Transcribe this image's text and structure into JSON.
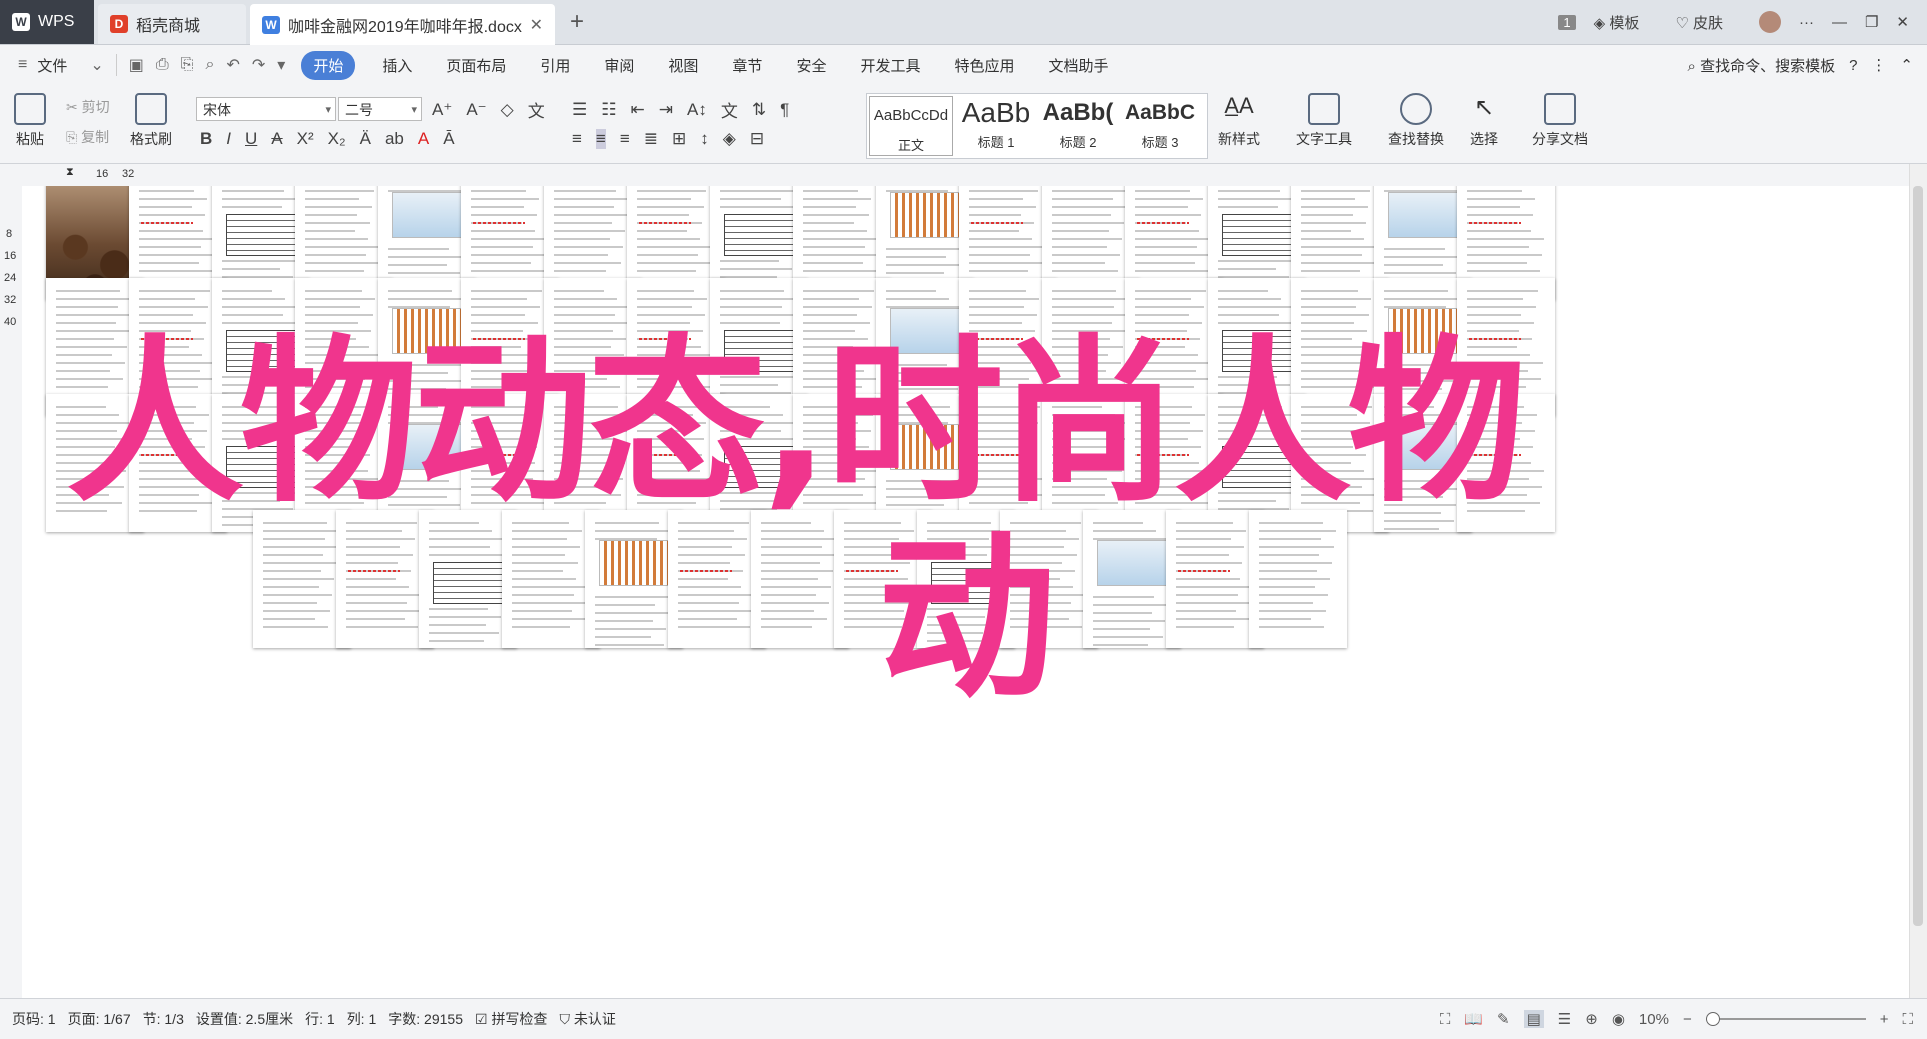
{
  "tabs": {
    "wps": "WPS",
    "shop": "稻壳商城",
    "doc": "咖啡金融网2019年咖啡年报.docx",
    "titlebar_right": {
      "page_badge": "1",
      "template": "模板",
      "skin": "皮肤"
    }
  },
  "menu": {
    "file": "文件",
    "items": [
      "开始",
      "插入",
      "页面布局",
      "引用",
      "审阅",
      "视图",
      "章节",
      "安全",
      "开发工具",
      "特色应用",
      "文档助手"
    ],
    "active": "开始",
    "search": "查找命令、搜索模板"
  },
  "ribbon": {
    "paste": "粘贴",
    "cut": "剪切",
    "copy": "复制",
    "format_painter": "格式刷",
    "font_name": "宋体",
    "font_size": "二号",
    "styles": [
      {
        "sample": "AaBbCcDd",
        "label": "正文"
      },
      {
        "sample": "AaBb",
        "label": "标题 1"
      },
      {
        "sample": "AaBb(",
        "label": "标题 2"
      },
      {
        "sample": "AaBbC",
        "label": "标题 3"
      }
    ],
    "new_style": "新样式",
    "text_tools": "文字工具",
    "find_replace": "查找替换",
    "select": "选择",
    "share": "分享文档"
  },
  "ruler": {
    "h_marks": [
      "16",
      "32"
    ],
    "v_marks": [
      "8",
      "16",
      "24",
      "32",
      "40"
    ]
  },
  "overlay": {
    "line1": "人物动态,时尚人物",
    "line2": "动"
  },
  "status": {
    "page": "页码: 1",
    "pages": "页面: 1/67",
    "section": "节: 1/3",
    "setting": "设置值: 2.5厘米",
    "row": "行: 1",
    "col": "列: 1",
    "words": "字数: 29155",
    "spell": "拼写检查",
    "cert": "未认证",
    "zoom": "10%"
  }
}
